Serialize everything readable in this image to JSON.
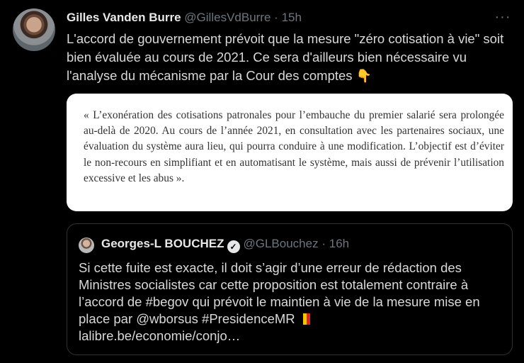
{
  "tweet": {
    "author_name": "Gilles Vanden Burre",
    "author_handle": "@GillesVdBurre",
    "separator": "·",
    "time": "15h",
    "more_label": "···",
    "text": "L'accord de gouvernement prévoit que la mesure \"zéro cotisation à vie\" soit bien évaluée au cours de 2021. Ce sera d'ailleurs bien nécessaire vu l'analyse du mécanisme par la Cour des comptes",
    "emoji": "👇"
  },
  "image": {
    "text": "« L’exonération des cotisations patronales pour l’embauche du premier salarié sera prolongée au-delà de 2020. Au cours de l’année 2021, en consultation avec les partenaires sociaux, une évaluation du système aura lieu, qui pourra conduire à une modification. L’objectif est d’éviter le non-recours en simplifiant et en automatisant le système, mais aussi de prévenir l’utilisation excessive et les abus »."
  },
  "quote": {
    "author_name": "Georges-L BOUCHEZ",
    "verified_icon": "✓",
    "author_handle": "@GLBouchez",
    "separator": "·",
    "time": "16h",
    "text": "Si cette fuite est exacte, il doit s’agir d’une erreur de rédaction des Ministres socialistes car cette proposition est totalement contraire à l’accord de #begov qui prévoit le maintien à vie de la mesure mise en place par @wborsus #PresidenceMR",
    "link": "lalibre.be/economie/conjo…",
    "flag_colors": [
      "#000000",
      "#f4c400",
      "#e41f26"
    ]
  }
}
